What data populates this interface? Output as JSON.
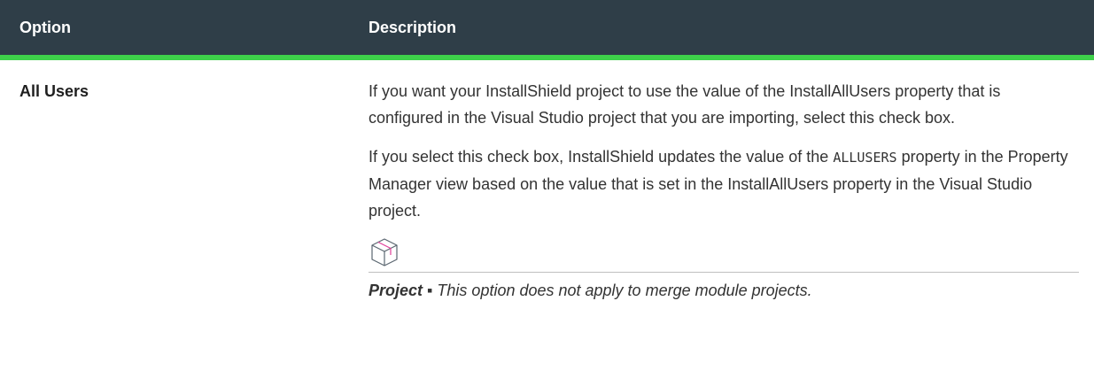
{
  "table": {
    "headers": {
      "option": "Option",
      "description": "Description"
    },
    "rows": [
      {
        "option": "All Users",
        "paragraph1": "If you want your InstallShield project to use the value of the InstallAllUsers property that is configured in the Visual Studio project that you are importing, select this check box.",
        "paragraph2_before": "If you select this check box, InstallShield updates the value of the ",
        "paragraph2_code": "ALLUSERS",
        "paragraph2_after": " property in the Property Manager view based on the value that is set in the InstallAllUsers property in the Visual Studio project.",
        "note": {
          "icon": "package-box-icon",
          "label": "Project",
          "separator": " ▪ ",
          "text": "This option does not apply to merge module projects."
        }
      }
    ]
  },
  "colors": {
    "header_bg": "#2f3e48",
    "header_accent": "#3ed14a",
    "header_text": "#ffffff"
  }
}
